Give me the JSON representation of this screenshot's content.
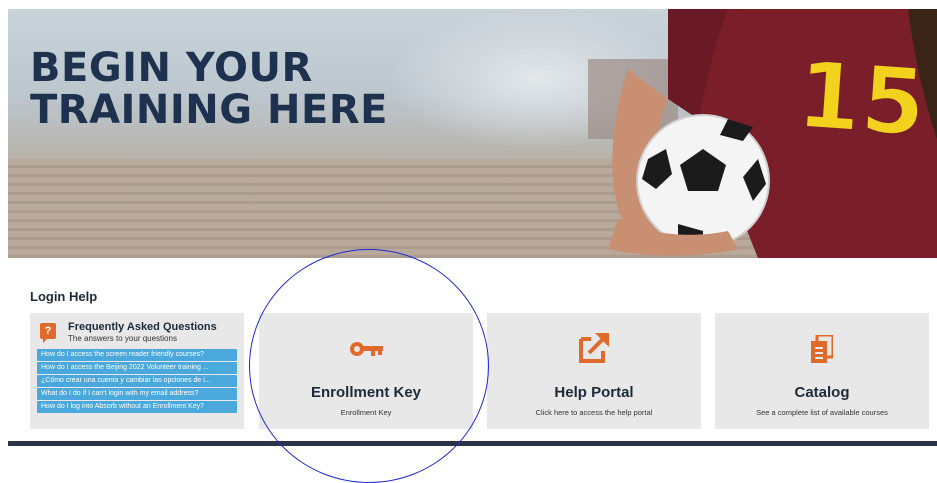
{
  "hero": {
    "title": "BEGIN YOUR\nTRAINING HERE",
    "jersey_number": "15"
  },
  "login_help": {
    "title": "Login Help",
    "faq": {
      "title": "Frequently Asked Questions",
      "subtitle": "The answers to your questions",
      "icon": "question-icon",
      "items": [
        "How do I access the screen reader friendly courses?",
        "How do I access the Beijing 2022 Volunteer training ...",
        "¿Cómo crear una cuenta y cambiar las opciones de i...",
        "What do I do if I can't login with my email address?",
        "How do I log into Absorb without an Enrollment Key?"
      ]
    },
    "enrollment_key": {
      "title": "Enrollment Key",
      "description": "Enrollment Key",
      "icon": "key-icon"
    },
    "help_portal": {
      "title": "Help Portal",
      "description": "Click here to access the help portal",
      "icon": "external-link-icon"
    },
    "catalog": {
      "title": "Catalog",
      "description": "See a complete list of available courses",
      "icon": "catalog-icon"
    }
  },
  "colors": {
    "accent": "#e06a2c",
    "faq_item_bg": "#4aa8dc",
    "hero_title": "#1e3250",
    "card_bg": "#e8e8e8",
    "annotation": "#1f2ad6"
  }
}
